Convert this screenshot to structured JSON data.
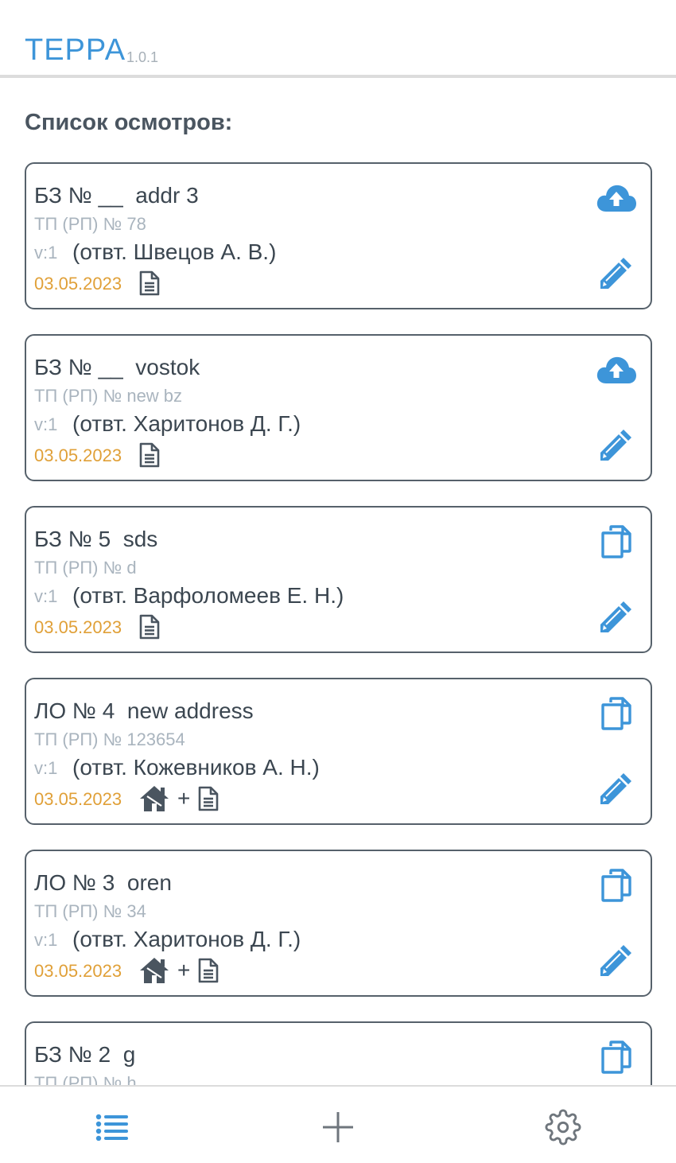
{
  "header": {
    "title": "ТЕРРА",
    "version": "1.0.1"
  },
  "section_title": "Список осмотров:",
  "colors": {
    "accent": "#3d95d9",
    "date": "#e0a038",
    "muted": "#a9b4be",
    "text": "#3b4650",
    "border": "#56616b"
  },
  "inspections": [
    {
      "title": "БЗ № __  addr 3",
      "subtitle": "ТП (РП) № 78",
      "version": "v:1",
      "responsible": "(отвт. Швецов А. В.)",
      "date": "03.05.2023",
      "status_icons": [
        "document-icon"
      ],
      "top_action": "cloud-upload-icon"
    },
    {
      "title": "БЗ № __  vostok",
      "subtitle": "ТП (РП) № new bz",
      "version": "v:1",
      "responsible": "(отвт. Харитонов Д. Г.)",
      "date": "03.05.2023",
      "status_icons": [
        "document-icon"
      ],
      "top_action": "cloud-upload-icon"
    },
    {
      "title": "БЗ № 5  sds",
      "subtitle": "ТП (РП) № d",
      "version": "v:1",
      "responsible": "(отвт. Варфоломеев Е. Н.)",
      "date": "03.05.2023",
      "status_icons": [
        "document-icon"
      ],
      "top_action": "copy-icon"
    },
    {
      "title": "ЛО № 4  new address",
      "subtitle": "ТП (РП) № 123654",
      "version": "v:1",
      "responsible": "(отвт. Кожевников А. Н.)",
      "date": "03.05.2023",
      "status_icons": [
        "house-icon",
        "document-icon"
      ],
      "plus": "+",
      "top_action": "copy-icon"
    },
    {
      "title": "ЛО № 3  oren",
      "subtitle": "ТП (РП) № 34",
      "version": "v:1",
      "responsible": "(отвт. Харитонов Д. Г.)",
      "date": "03.05.2023",
      "status_icons": [
        "house-icon",
        "document-icon"
      ],
      "plus": "+",
      "top_action": "copy-icon"
    },
    {
      "title": "БЗ № 2  g",
      "subtitle": "ТП (РП) № h",
      "version": "",
      "responsible": "",
      "date": "",
      "status_icons": [],
      "top_action": "copy-icon"
    }
  ],
  "bottom_nav": {
    "items": [
      {
        "icon": "list-icon",
        "active": true
      },
      {
        "icon": "plus-icon",
        "active": false
      },
      {
        "icon": "gear-icon",
        "active": false
      }
    ]
  }
}
